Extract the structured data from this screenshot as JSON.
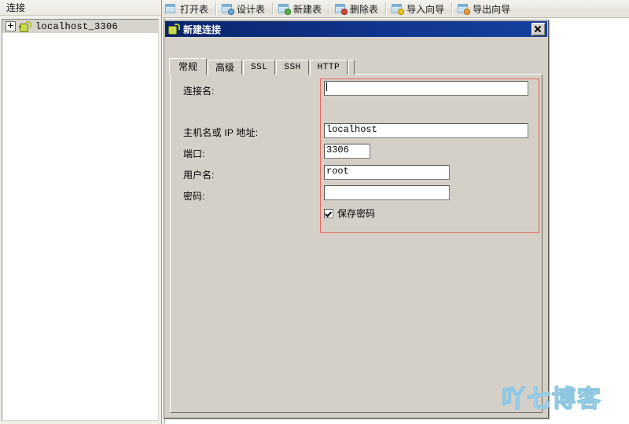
{
  "window": {
    "workspace_bg": "#ffffff",
    "chrome_bg": "#d4d0c8"
  },
  "left_panel": {
    "header_label": "连接",
    "tree": {
      "items": [
        {
          "label": "localhost_3306",
          "icon": "connection-plug-icon",
          "expanded": false,
          "selected": true
        }
      ]
    }
  },
  "toolbar": {
    "buttons": [
      {
        "label": "打开表",
        "icon": "open-table-icon",
        "badge": "none"
      },
      {
        "label": "设计表",
        "icon": "design-table-icon",
        "badge": "blue"
      },
      {
        "label": "新建表",
        "icon": "new-table-icon",
        "badge": "green"
      },
      {
        "label": "删除表",
        "icon": "delete-table-icon",
        "badge": "red"
      },
      {
        "label": "导入向导",
        "icon": "import-wizard-icon",
        "badge": "yellow"
      },
      {
        "label": "导出向导",
        "icon": "export-wizard-icon",
        "badge": "orange"
      }
    ]
  },
  "dialog": {
    "title": "新建连接",
    "title_icon": "connection-plug-icon",
    "close_label": "✕",
    "tabs": [
      {
        "label": "常规",
        "active": true,
        "mono": false
      },
      {
        "label": "高级",
        "active": false,
        "mono": false
      },
      {
        "label": "SSL",
        "active": false,
        "mono": true
      },
      {
        "label": "SSH",
        "active": false,
        "mono": true
      },
      {
        "label": "HTTP",
        "active": false,
        "mono": true
      }
    ],
    "form": {
      "connection_name": {
        "label": "连接名:",
        "value": "",
        "placeholder": ""
      },
      "host": {
        "label": "主机名或 IP 地址:",
        "value": "localhost",
        "placeholder": ""
      },
      "port": {
        "label": "端口:",
        "value": "3306",
        "placeholder": ""
      },
      "username": {
        "label": "用户名:",
        "value": "root",
        "placeholder": ""
      },
      "password": {
        "label": "密码:",
        "value": "",
        "placeholder": ""
      },
      "save_password": {
        "label": "保存密码",
        "checked": true
      }
    },
    "highlight": {
      "color": "#e8665c",
      "note": "red annotation rectangle around the input fields"
    }
  },
  "watermark": {
    "text": "吖七博客",
    "color": "#8cc6e0"
  }
}
